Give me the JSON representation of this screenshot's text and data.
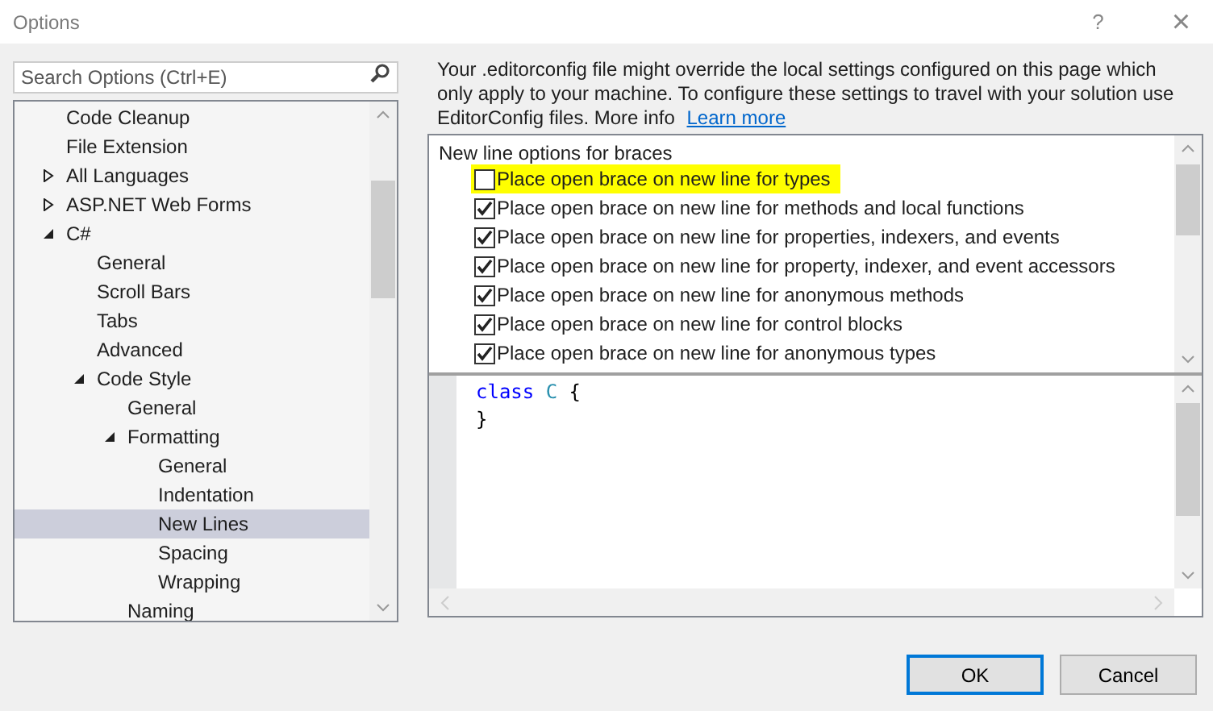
{
  "window": {
    "title": "Options",
    "help": "?",
    "close": "×"
  },
  "search": {
    "placeholder": "Search Options (Ctrl+E)"
  },
  "tree": [
    {
      "label": "Code Cleanup",
      "selected": false
    },
    {
      "label": "File Extension",
      "selected": false
    },
    {
      "label": "All Languages",
      "selected": false,
      "expanded": false
    },
    {
      "label": "ASP.NET Web Forms",
      "selected": false,
      "expanded": false
    },
    {
      "label": "C#",
      "selected": false,
      "expanded": true,
      "children": [
        {
          "label": "General",
          "selected": false
        },
        {
          "label": "Scroll Bars",
          "selected": false
        },
        {
          "label": "Tabs",
          "selected": false
        },
        {
          "label": "Advanced",
          "selected": false
        },
        {
          "label": "Code Style",
          "selected": false,
          "expanded": true,
          "children": [
            {
              "label": "General",
              "selected": false
            },
            {
              "label": "Formatting",
              "selected": false,
              "expanded": true,
              "children": [
                {
                  "label": "General",
                  "selected": false
                },
                {
                  "label": "Indentation",
                  "selected": false
                },
                {
                  "label": "New Lines",
                  "selected": true
                },
                {
                  "label": "Spacing",
                  "selected": false
                },
                {
                  "label": "Wrapping",
                  "selected": false
                }
              ]
            },
            {
              "label": "Naming",
              "selected": false
            }
          ]
        }
      ]
    }
  ],
  "info": {
    "text": "Your .editorconfig file might override the local settings configured on this page which only apply to your machine. To configure these settings to travel with your solution use EditorConfig files. More info",
    "link": "Learn more"
  },
  "options": {
    "group": "New line options for braces",
    "items": [
      {
        "label": "Place open brace on new line for types",
        "checked": false,
        "highlighted": true
      },
      {
        "label": "Place open brace on new line for methods and local functions",
        "checked": true,
        "highlighted": false
      },
      {
        "label": "Place open brace on new line for properties, indexers, and events",
        "checked": true,
        "highlighted": false
      },
      {
        "label": "Place open brace on new line for property, indexer, and event accessors",
        "checked": true,
        "highlighted": false
      },
      {
        "label": "Place open brace on new line for anonymous methods",
        "checked": true,
        "highlighted": false
      },
      {
        "label": "Place open brace on new line for control blocks",
        "checked": true,
        "highlighted": false
      },
      {
        "label": "Place open brace on new line for anonymous types",
        "checked": true,
        "highlighted": false
      }
    ]
  },
  "preview": {
    "lines": [
      [
        {
          "text": "class",
          "kind": "keyword"
        },
        {
          "text": "C",
          "kind": "type"
        },
        {
          "text": "{",
          "kind": "plain"
        }
      ],
      [
        {
          "text": "}",
          "kind": "plain"
        }
      ]
    ]
  },
  "buttons": [
    {
      "label": "OK",
      "default": true
    },
    {
      "label": "Cancel",
      "default": false
    }
  ]
}
